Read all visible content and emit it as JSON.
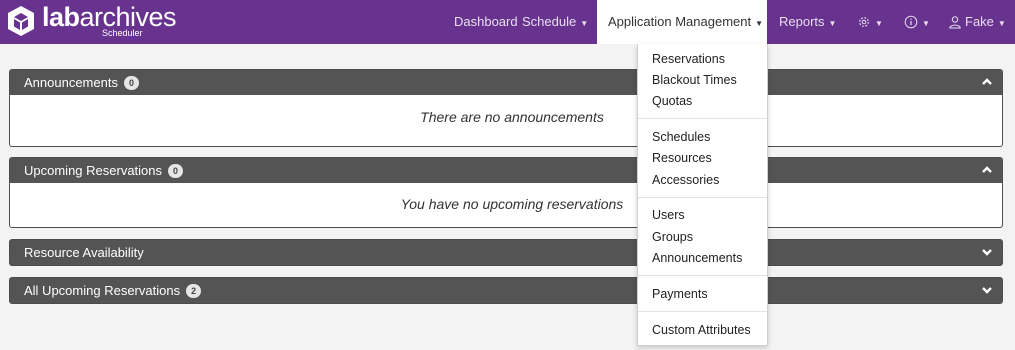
{
  "brand": {
    "name_bold": "lab",
    "name_light": "archives",
    "subtitle": "Scheduler"
  },
  "nav": {
    "dashboard": "Dashboard",
    "schedule": "Schedule",
    "app_management": "Application Management",
    "reports": "Reports",
    "user": "Fake"
  },
  "panels": {
    "announcements": {
      "title": "Announcements",
      "count": "0",
      "empty_text": "There are no announcements"
    },
    "upcoming": {
      "title": "Upcoming Reservations",
      "count": "0",
      "empty_text": "You have no upcoming reservations"
    },
    "availability": {
      "title": "Resource Availability"
    },
    "all_upcoming": {
      "title": "All Upcoming Reservations",
      "count": "2"
    }
  },
  "menu": {
    "items": [
      "Reservations",
      "Blackout Times",
      "Quotas",
      "Schedules",
      "Resources",
      "Accessories",
      "Users",
      "Groups",
      "Announcements",
      "Payments",
      "Custom Attributes"
    ]
  },
  "colors": {
    "nav_bg": "#67338f",
    "panel_header": "#545454",
    "page_bg": "#f3f3f3"
  }
}
